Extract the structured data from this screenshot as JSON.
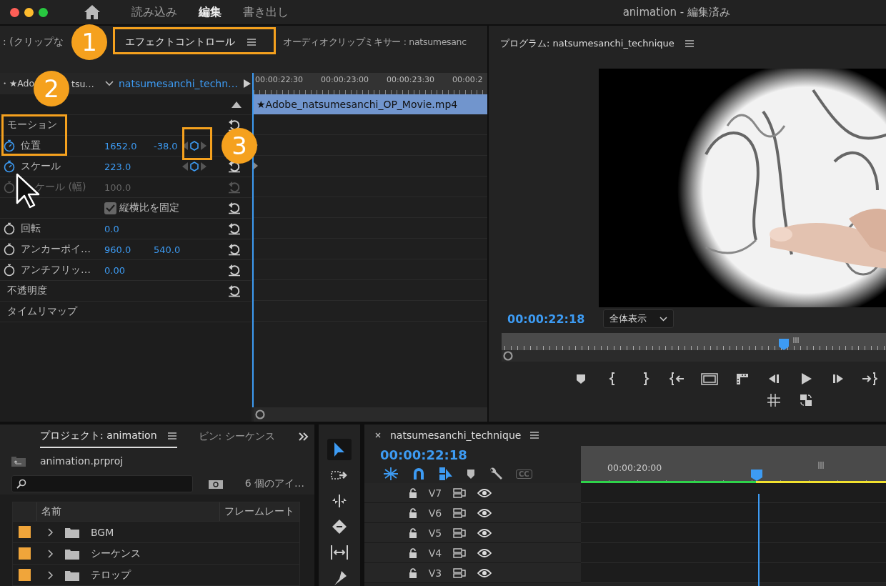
{
  "app_bar": {
    "window_buttons": [
      {
        "color": "#fe5f57"
      },
      {
        "color": "#febc2e"
      },
      {
        "color": "#28c840"
      }
    ],
    "workspaces": [
      {
        "label": "読み込み",
        "selected": false
      },
      {
        "label": "編集",
        "selected": true
      },
      {
        "label": "書き出し",
        "selected": false
      }
    ],
    "title": "animation - 編集済み"
  },
  "effect_controls": {
    "tabs": [
      {
        "label": ": (クリップな",
        "selected": false
      },
      {
        "label": "エフェクトコントロール",
        "selected": true
      },
      {
        "label": "オーディオクリップミキサー : natsumesanc",
        "selected": false
      }
    ],
    "source_clip": [
      "・★Ado",
      "tsu…"
    ],
    "sequence": "natsumesanchi_techn…",
    "ruler": [
      "00:00:22:30",
      "00:00:23:00",
      "00:00:23:30",
      "00:00:2"
    ],
    "clip": "★Adobe_natsumesanchi_OP_Movie.mp4",
    "properties": [
      {
        "kind": "group",
        "label": "モーション",
        "reset": true
      },
      {
        "kind": "param",
        "label": "位置",
        "values": [
          "1652.0",
          "-38.0"
        ],
        "animated": true,
        "disabled": false,
        "keyframe": true,
        "reset": false
      },
      {
        "kind": "param",
        "label": "スケール",
        "values": [
          "223.0"
        ],
        "animated": true,
        "disabled": false,
        "keyframe": true,
        "reset": true
      },
      {
        "kind": "param",
        "label": "ケール (幅)",
        "values": [
          "100.0"
        ],
        "animated": false,
        "disabled": true,
        "keyframe": false,
        "reset": true
      },
      {
        "kind": "checkbox",
        "label": "縦横比を固定",
        "checked": true,
        "reset": true
      },
      {
        "kind": "param",
        "label": "回転",
        "values": [
          "0.0"
        ],
        "animated": false,
        "disabled": false,
        "keyframe": false,
        "reset": true
      },
      {
        "kind": "param",
        "label": "アンカーポイ…",
        "values": [
          "960.0",
          "540.0"
        ],
        "animated": false,
        "disabled": false,
        "keyframe": false,
        "reset": true
      },
      {
        "kind": "param",
        "label": "アンチフリッ…",
        "values": [
          "0.00"
        ],
        "animated": false,
        "disabled": false,
        "keyframe": false,
        "reset": true
      },
      {
        "kind": "group",
        "label": "不透明度",
        "reset": true
      },
      {
        "kind": "group",
        "label": "タイムリマップ",
        "reset": false
      }
    ],
    "callouts": [
      {
        "label": "1"
      },
      {
        "label": "2"
      },
      {
        "label": "3"
      }
    ]
  },
  "program": {
    "title": "プログラム: natsumesanchi_technique",
    "timecode": "00:00:22:18",
    "fit": "全体表示"
  },
  "project": {
    "tabs": [
      {
        "label": "プロジェクト: animation",
        "selected": true
      },
      {
        "label": "ビン: シーケンス",
        "selected": false
      }
    ],
    "file": "animation.prproj",
    "item_count": "6 個のアイ…",
    "columns": [
      "名前",
      "フレームレート"
    ],
    "rows": [
      {
        "name": "BGM",
        "color": "#f0a53a"
      },
      {
        "name": "シーケンス",
        "color": "#f0a53a"
      },
      {
        "name": "テロップ",
        "color": "#f0a53a"
      }
    ]
  },
  "tools": [
    {
      "kind": "select",
      "selected": true
    },
    {
      "kind": "track-select",
      "selected": false
    },
    {
      "kind": "ripple",
      "selected": false
    },
    {
      "kind": "razor",
      "selected": false
    },
    {
      "kind": "slip",
      "selected": false
    },
    {
      "kind": "pen",
      "selected": false
    }
  ],
  "timeline": {
    "title": "natsumesanchi_technique",
    "timecode": "00:00:22:18",
    "toolbar": [
      {
        "kind": "nest",
        "on": true
      },
      {
        "kind": "snap",
        "on": true
      },
      {
        "kind": "linked",
        "on": true
      },
      {
        "kind": "marker",
        "on": false
      },
      {
        "kind": "wrench",
        "on": false
      },
      {
        "kind": "captions",
        "on": false,
        "label": "CC"
      }
    ],
    "ruler_label": "00:00:20:00",
    "tracks": [
      "V7",
      "V6",
      "V5",
      "V4",
      "V3"
    ]
  }
}
